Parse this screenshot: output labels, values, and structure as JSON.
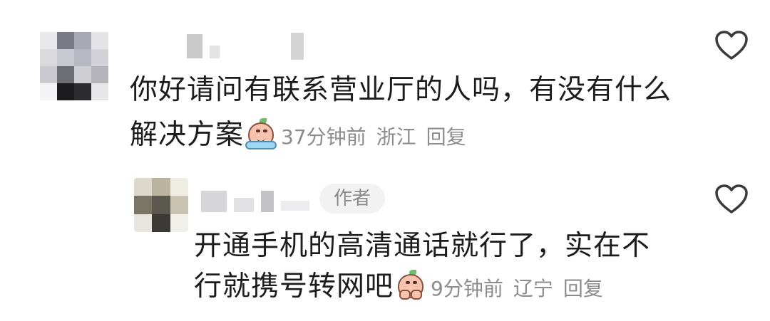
{
  "comments": [
    {
      "text_line1": "你好请问有联系营业厅的人吗，有没有什么",
      "text_line2": "解决方案",
      "emoji_icon": "crying-emoji-icon",
      "time": "37分钟前",
      "location": "浙江",
      "reply_label": "回复"
    },
    {
      "author_badge": "作者",
      "text_line1": "开通手机的高清通话就行了，实在不",
      "text_line2": "行就携号转网吧",
      "emoji_icon": "praying-emoji-icon",
      "time": "9分钟前",
      "location": "辽宁",
      "reply_label": "回复"
    }
  ],
  "colors": {
    "text": "#1c1c1c",
    "meta": "#8c8c8c",
    "badge_bg": "#f2f2f2",
    "heart_stroke": "#3a3a3a"
  },
  "icons": [
    "like-heart-icon",
    "crying-emoji-icon",
    "praying-emoji-icon"
  ]
}
